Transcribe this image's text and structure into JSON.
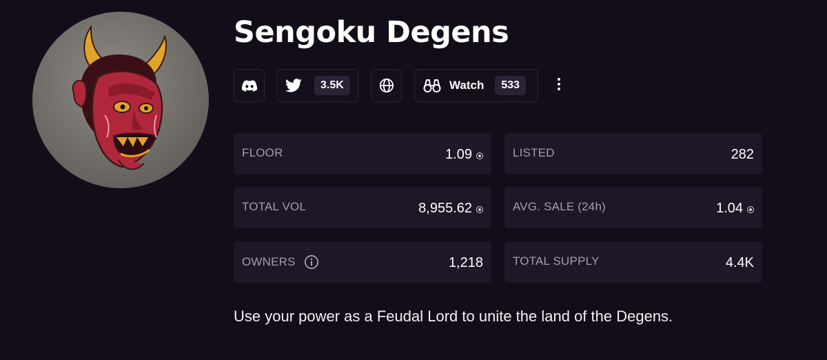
{
  "collection": {
    "name": "Sengoku Degens",
    "description": "Use your power as a Feudal Lord to unite the land of the Degens."
  },
  "socials": {
    "twitter_followers": "3.5K",
    "watch_label": "Watch",
    "watch_count": "533"
  },
  "stats": [
    {
      "label": "FLOOR",
      "value": "1.09",
      "currency_icon": "sol-icon"
    },
    {
      "label": "LISTED",
      "value": "282"
    },
    {
      "label": "TOTAL VOL",
      "value": "8,955.62",
      "currency_icon": "sol-icon"
    },
    {
      "label": "AVG. SALE (24h)",
      "value": "1.04",
      "currency_icon": "sol-icon"
    },
    {
      "label": "OWNERS",
      "value": "1,218",
      "info_icon": "info-icon"
    },
    {
      "label": "TOTAL SUPPLY",
      "value": "4.4K"
    }
  ],
  "icons": {
    "discord": "discord-icon",
    "twitter": "twitter-icon",
    "website": "globe-icon",
    "watch": "binoculars-icon",
    "more": "more-vertical-icon"
  },
  "colors": {
    "background": "#120d18",
    "card": "#1e1727",
    "label": "#a49eae",
    "mask_red": "#b0263a",
    "mask_gold": "#e0a42a"
  }
}
